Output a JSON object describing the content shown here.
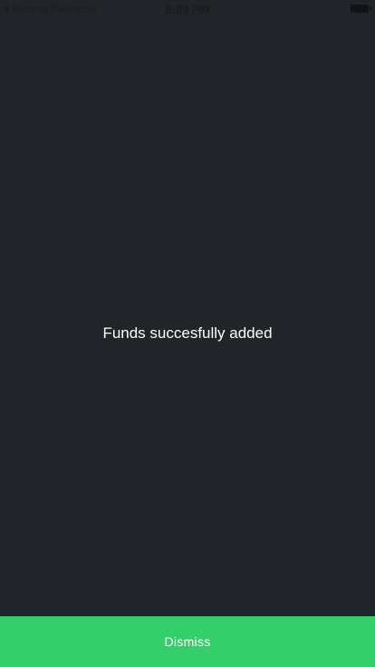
{
  "status_bar": {
    "back_label": "Back to FunFacts",
    "time": "8:09 PM",
    "battery_icon": "battery-icon"
  },
  "main": {
    "message": "Funds succesfully added"
  },
  "footer": {
    "dismiss_label": "Dismiss"
  },
  "colors": {
    "background": "#212529",
    "accent": "#34ce6a",
    "text": "#ffffff"
  }
}
